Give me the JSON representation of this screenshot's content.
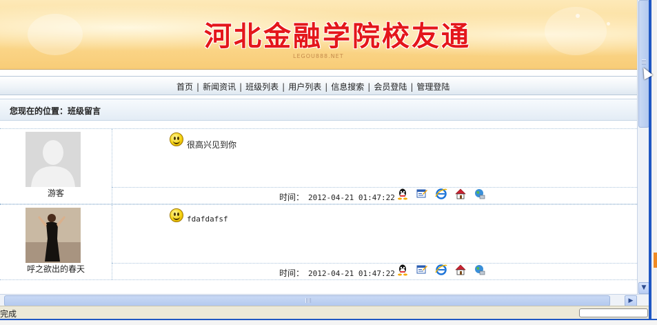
{
  "banner": {
    "title": "河北金融学院校友通",
    "subtitle": "LEGOU888.NET"
  },
  "nav": {
    "items": [
      "首页",
      "新闻资讯",
      "班级列表",
      "用户列表",
      "信息搜索",
      "会员登陆",
      "管理登陆"
    ],
    "separator": "|"
  },
  "location": {
    "text": "您现在的位置：班级留言"
  },
  "messages": [
    {
      "user": "游客",
      "content": "很高兴见到你",
      "time_label": "时间：",
      "time": "2012-04-21 01:47:22"
    },
    {
      "user": "呼之欲出的春天",
      "content": "fdafdafsf",
      "time_label": "时间：",
      "time": "2012-04-21 01:47:22"
    }
  ],
  "message_icons": [
    "qq-icon",
    "edit-icon",
    "ie-icon",
    "home-icon",
    "globe-icon"
  ],
  "statusbar": {
    "text": "完成"
  },
  "colors": {
    "banner_title": "#e4161b",
    "window_frame": "#1f57c3",
    "border": "#a9c3db"
  }
}
